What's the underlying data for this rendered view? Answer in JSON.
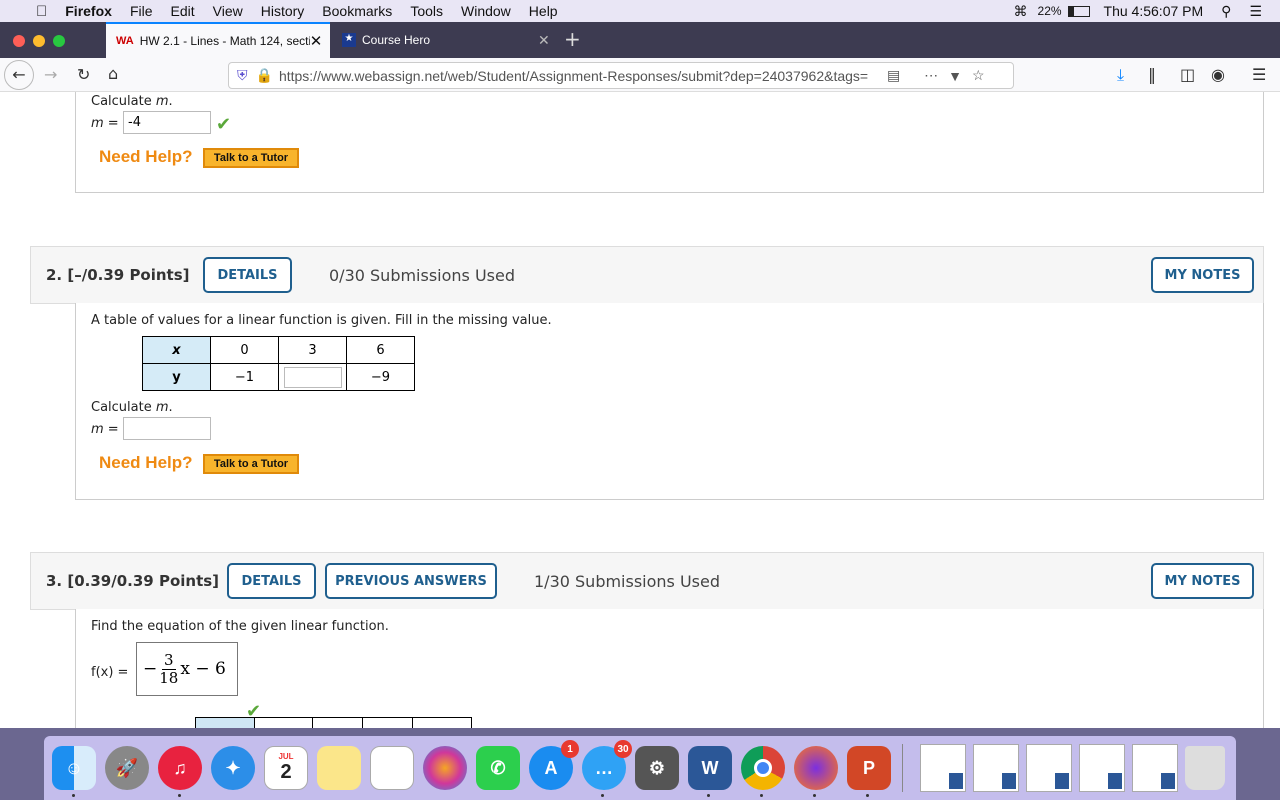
{
  "menubar": {
    "app": "Firefox",
    "items": [
      "File",
      "Edit",
      "View",
      "History",
      "Bookmarks",
      "Tools",
      "Window",
      "Help"
    ],
    "battery": "22%",
    "clock": "Thu 4:56:07 PM"
  },
  "tabs": [
    {
      "label": "HW 2.1 - Lines - Math 124, sectio",
      "favicon": "WA",
      "active": true
    },
    {
      "label": "Course Hero",
      "active": false
    }
  ],
  "navbar": {
    "url": "https://www.webassign.net/web/Student/Assignment-Responses/submit?dep=24037962&tags="
  },
  "q1": {
    "calc_label": "Calculate",
    "var": "m",
    "m_label": "m =",
    "m_value": "-4",
    "need_help": "Need Help?",
    "tutor": "Talk to a Tutor"
  },
  "q2": {
    "number": "2.",
    "points": "[–/0.39 Points]",
    "details": "DETAILS",
    "submissions": "0/30 Submissions Used",
    "my_notes": "MY NOTES",
    "prompt": "A table of values for a linear function is given. Fill in the missing value.",
    "table": {
      "x_label": "x",
      "y_label": "y",
      "x": [
        "0",
        "3",
        "6"
      ],
      "y": [
        "−1",
        "",
        "−9"
      ]
    },
    "calc_label": "Calculate",
    "var": "m",
    "m_label": "m =",
    "m_value": "",
    "need_help": "Need Help?",
    "tutor": "Talk to a Tutor"
  },
  "q3": {
    "number": "3.",
    "points": "[0.39/0.39 Points]",
    "details": "DETAILS",
    "prev": "PREVIOUS ANSWERS",
    "submissions": "1/30 Submissions Used",
    "my_notes": "MY NOTES",
    "prompt": "Find the equation of the given linear function.",
    "f_label": "f(x) =",
    "answer": {
      "sign": "−",
      "num": "3",
      "den": "18",
      "rest": "x − 6"
    }
  },
  "dock": {
    "calendar_month": "JUL",
    "calendar_day": "2",
    "appstore_badge": "1",
    "messages_badge": "30"
  },
  "colors": {
    "accent": "#1f5f8e",
    "help": "#ef8a12",
    "check": "#5aa83a"
  }
}
